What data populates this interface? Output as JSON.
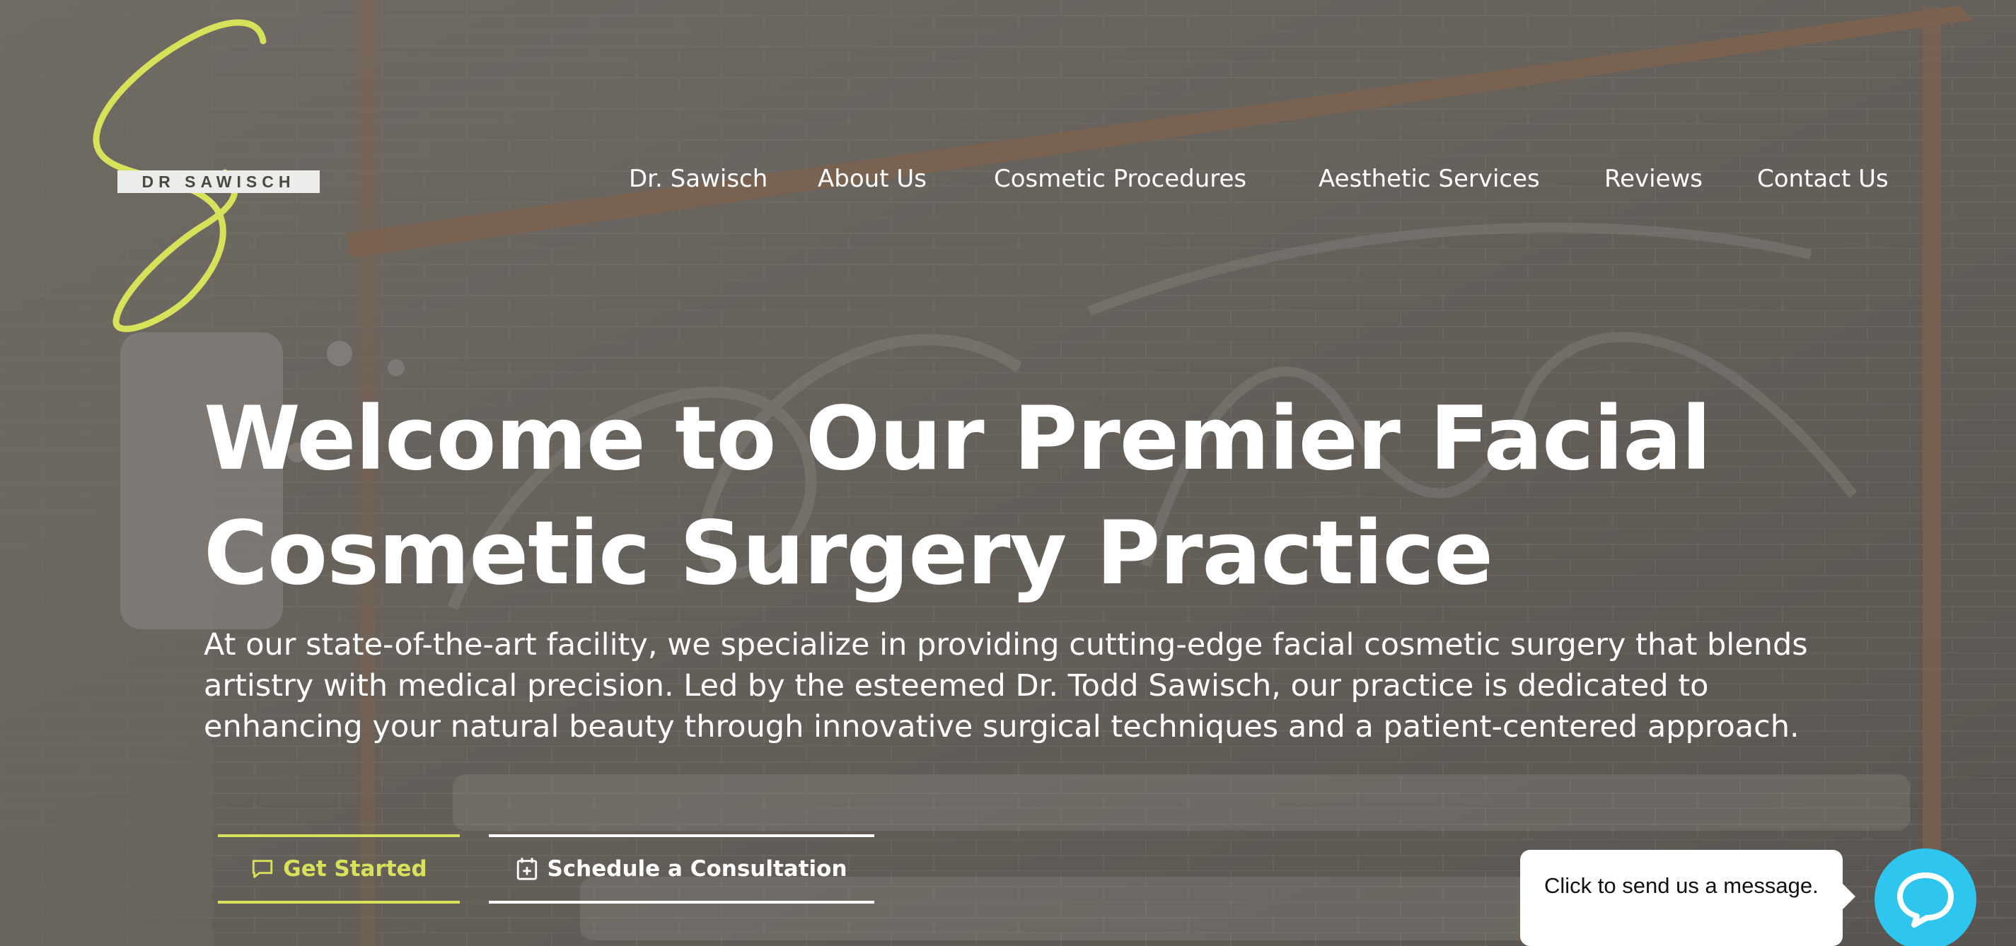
{
  "brand": {
    "logo_text": "DR SAWISCH",
    "accent_color": "#d6e25a"
  },
  "nav": {
    "items": [
      {
        "label": "Dr. Sawisch"
      },
      {
        "label": "About Us"
      },
      {
        "label": "Cosmetic Procedures"
      },
      {
        "label": "Aesthetic Services"
      },
      {
        "label": "Reviews"
      },
      {
        "label": "Contact Us"
      }
    ]
  },
  "hero": {
    "title_line1": "Welcome to Our Premier Facial",
    "title_line2": "Cosmetic Surgery Practice",
    "intro": "At our state-of-the-art facility, we specialize in providing cutting-edge facial cosmetic surgery that blends artistry with medical precision. Led by the esteemed Dr. Todd Sawisch, our practice is dedicated to enhancing your natural beauty through innovative surgical techniques and a patient-centered approach."
  },
  "actions": {
    "get_started": {
      "label": "Get Started",
      "icon": "chat-bubble-icon",
      "color": "#d6e25a"
    },
    "schedule": {
      "label": "Schedule a Consultation",
      "icon": "calendar-plus-icon",
      "color": "#ffffff"
    }
  },
  "chat": {
    "prompt": "Click to send us a message.",
    "launcher_color": "#2ec6ef",
    "icon": "chat-icon"
  }
}
